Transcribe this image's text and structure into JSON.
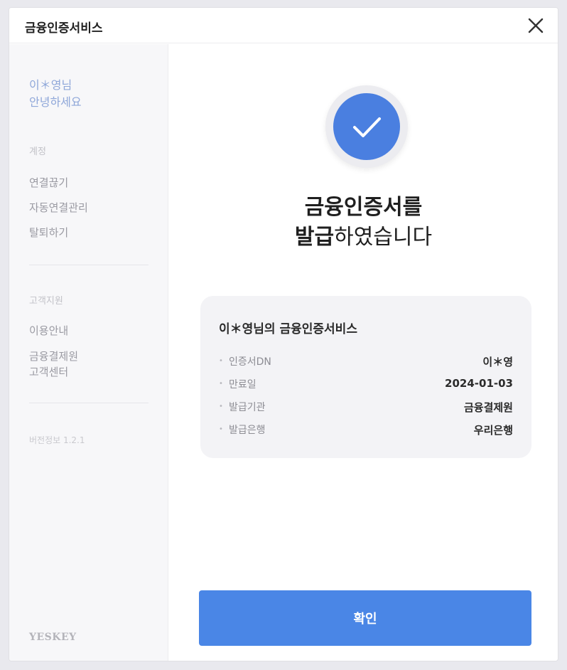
{
  "window": {
    "title": "금융인증서비스"
  },
  "sidebar": {
    "greeting_name": "이＊영님",
    "greeting_text": "안녕하세요",
    "account_section": "계정",
    "account_items": [
      "연결끊기",
      "자동연결관리",
      "탈퇴하기"
    ],
    "support_section": "고객지원",
    "support_items": [
      "이용안내",
      "금융결제원",
      "고객센터"
    ],
    "version": "버전정보 1.2.1",
    "brand": "YESKEY"
  },
  "main": {
    "headline_line1": "금융인증서를",
    "headline_line2_bold": "발급",
    "headline_line2_rest": "하였습니다",
    "card": {
      "title": "이＊영님의 금융인증서비스",
      "rows": [
        {
          "label": "인증서DN",
          "value": "이＊영"
        },
        {
          "label": "만료일",
          "value": "2024-01-03"
        },
        {
          "label": "발급기관",
          "value": "금융결제원"
        },
        {
          "label": "발급은행",
          "value": "우리은행"
        }
      ]
    },
    "confirm_label": "확인"
  },
  "colors": {
    "accent": "#4a7fe0",
    "button": "#4a86e6",
    "greeting": "#8fa7d9"
  },
  "icons": {
    "close": "close-icon",
    "success": "check-icon"
  }
}
